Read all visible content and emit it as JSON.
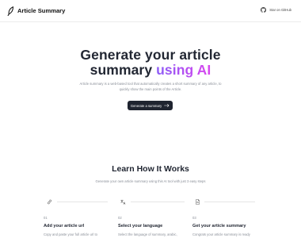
{
  "navbar": {
    "brand": "Article Summary",
    "github_label": "Star on GitHub"
  },
  "hero": {
    "title_line1": "Generate your article",
    "title_plain": "summary ",
    "title_highlight": "using AI",
    "subtitle": "Article summary is a web-based tool that automatically creates a short summary of any article, to quickly show the main points of the Article.",
    "cta_label": "Generate a summary",
    "accent_gradient": [
      "#8b5cf6",
      "#d946ef"
    ],
    "cta_color": "#1f2430"
  },
  "how_it_works": {
    "title": "Learn How It Works",
    "subtitle": "Generate your own article summary using this AI tool with just 3 easy steps",
    "steps": [
      {
        "icon": "link-icon",
        "number": "01",
        "title": "Add your article url",
        "description": "Copy and paste your full article url to"
      },
      {
        "icon": "translate-icon",
        "number": "02",
        "title": "Select your language",
        "description": "Select the language of summary, arabic,"
      },
      {
        "icon": "document-icon",
        "number": "03",
        "title": "Get your article summary",
        "description": "Congrats your article summary is ready"
      }
    ]
  }
}
